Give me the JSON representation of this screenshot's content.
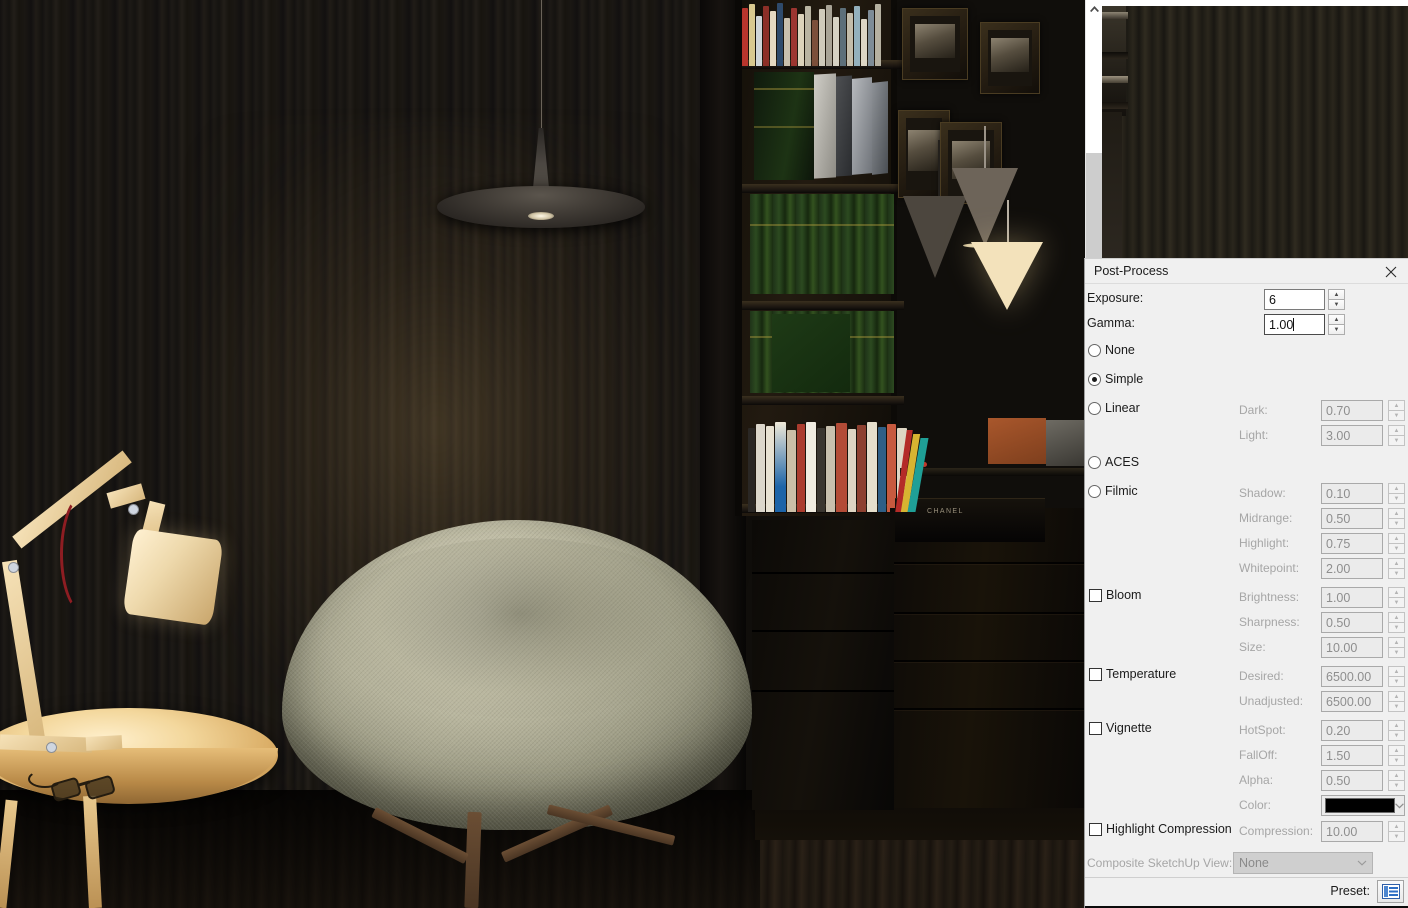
{
  "window": {
    "render_viewport_name": "render-viewport",
    "scrollbar": {
      "up_arrow": "scroll-up-arrow"
    }
  },
  "dialog": {
    "title": "Post-Process",
    "close_icon": "close-icon",
    "exposure": {
      "label": "Exposure:",
      "value": "6"
    },
    "gamma": {
      "label": "Gamma:",
      "value": "1.00"
    },
    "tonemap_options": [
      {
        "label": "None",
        "checked": false
      },
      {
        "label": "Simple",
        "checked": true
      },
      {
        "label": "Linear",
        "checked": false
      },
      {
        "label": "ACES",
        "checked": false
      },
      {
        "label": "Filmic",
        "checked": false
      }
    ],
    "linear_params": [
      {
        "label": "Dark:",
        "value": "0.70"
      },
      {
        "label": "Light:",
        "value": "3.00"
      }
    ],
    "filmic_params": [
      {
        "label": "Shadow:",
        "value": "0.10"
      },
      {
        "label": "Midrange:",
        "value": "0.50"
      },
      {
        "label": "Highlight:",
        "value": "0.75"
      },
      {
        "label": "Whitepoint:",
        "value": "2.00"
      }
    ],
    "bloom": {
      "label": "Bloom",
      "checked": false,
      "params": [
        {
          "label": "Brightness:",
          "value": "1.00"
        },
        {
          "label": "Sharpness:",
          "value": "0.50"
        },
        {
          "label": "Size:",
          "value": "10.00"
        }
      ]
    },
    "temperature": {
      "label": "Temperature",
      "checked": false,
      "params": [
        {
          "label": "Desired:",
          "value": "6500.00"
        },
        {
          "label": "Unadjusted:",
          "value": "6500.00"
        }
      ]
    },
    "vignette": {
      "label": "Vignette",
      "checked": false,
      "params": [
        {
          "label": "HotSpot:",
          "value": "0.20"
        },
        {
          "label": "FallOff:",
          "value": "1.50"
        },
        {
          "label": "Alpha:",
          "value": "0.50"
        }
      ],
      "color": {
        "label": "Color:",
        "value": "#000000"
      }
    },
    "highlight_compression": {
      "label": "Highlight Compression",
      "checked": false,
      "param": {
        "label": "Compression:",
        "value": "10.00"
      }
    },
    "composite": {
      "label": "Composite SketchUp View:",
      "value": "None"
    },
    "preset": {
      "label": "Preset:",
      "icon": "preset-list-icon"
    }
  },
  "scene": {
    "description": "Rendered dark interior: wood-grain wall, pendant lamp, upholstered chair, side table with desk lamp and sunglasses, bookshelf with books, framed pictures, cone pendant lamps, credenza",
    "stereo_brand": "CHANEL"
  }
}
